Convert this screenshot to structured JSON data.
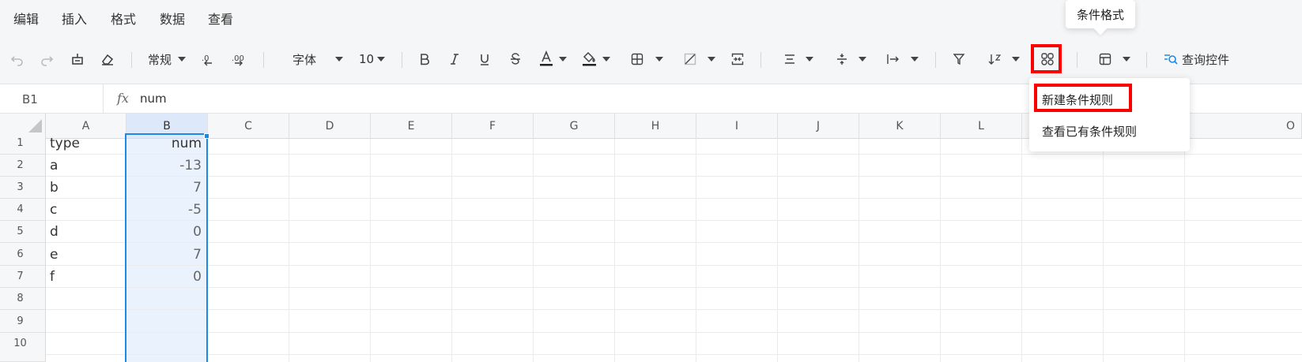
{
  "menu": {
    "items": [
      "编辑",
      "插入",
      "格式",
      "数据",
      "查看"
    ]
  },
  "toolbar": {
    "number_format": "常规",
    "font_name": "字体",
    "font_size": "10",
    "query_control_label": "查询控件",
    "conditional_format_tooltip": "条件格式"
  },
  "formula_bar": {
    "cell_ref": "B1",
    "fx": "fx",
    "value": "num"
  },
  "grid": {
    "columns": [
      "A",
      "B",
      "C",
      "D",
      "E",
      "F",
      "G",
      "H",
      "I",
      "J",
      "K",
      "L",
      "O"
    ],
    "rows": [
      "1",
      "2",
      "3",
      "4",
      "5",
      "6",
      "7",
      "8",
      "9",
      "10"
    ],
    "col_a": [
      "type",
      "a",
      "b",
      "c",
      "d",
      "e",
      "f"
    ],
    "col_b": [
      "num",
      "-13",
      "7",
      "-5",
      "0",
      "7",
      "0"
    ]
  },
  "dropdown": {
    "new_rule": "新建条件规则",
    "view_rules": "查看已有条件规则"
  },
  "colors": {
    "accent": "#1e88e5",
    "highlight": "#ff0000",
    "selection_fill": "#eaf2fd"
  }
}
